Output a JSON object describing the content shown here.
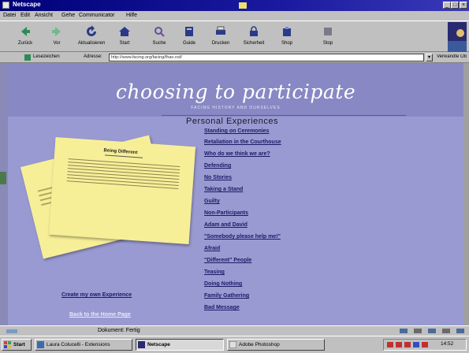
{
  "window": {
    "title": "Netscape",
    "min_glyph": "_",
    "max_glyph": "□",
    "close_glyph": "×"
  },
  "menu": [
    "Datei",
    "Edit",
    "Ansicht",
    "Gehe",
    "Communicator",
    "Hilfe"
  ],
  "toolbar": {
    "buttons": [
      {
        "label": "Zurück",
        "icon": "back-arrow-icon",
        "color": "#2e8b57"
      },
      {
        "label": "Vor",
        "icon": "forward-arrow-icon",
        "color": "#2e8b57"
      },
      {
        "label": "Aktualisieren",
        "icon": "reload-icon",
        "color": "#2a3a8a"
      },
      {
        "label": "Start",
        "icon": "home-icon",
        "color": "#2a3a8a"
      },
      {
        "label": "Suche",
        "icon": "search-icon",
        "color": "#6a4a9a"
      },
      {
        "label": "Guide",
        "icon": "guide-icon",
        "color": "#2a3a8a"
      },
      {
        "label": "Drucken",
        "icon": "print-icon",
        "color": "#2a3a8a"
      },
      {
        "label": "Sicherheit",
        "icon": "security-icon",
        "color": "#2a3a8a"
      },
      {
        "label": "Shop",
        "icon": "shop-icon",
        "color": "#2a3a8a"
      },
      {
        "label": "Stop",
        "icon": "stop-icon",
        "color": "#2a3a8a"
      }
    ]
  },
  "location": {
    "bookmarks_label": "Lesezeichen",
    "address_label": "Adresse:",
    "url": "http://www.facing.org/facing/fhao.nsf/",
    "related_label": "Verwandte Objekte"
  },
  "page": {
    "brand": "choosing to participate",
    "tagline": "FACING HISTORY AND OURSELVES",
    "section_title": "Personal Experiences",
    "links": [
      "Standing on Ceremonies",
      "Retaliation in the Courthouse",
      "Who do we think we are?",
      "Defending",
      "No Stories",
      "Taking a Stand",
      "Guilty",
      "Non-Participants",
      "Adam and David",
      "\"Somebody please help me!\"",
      "Afraid",
      "\"Different\" People",
      "Teasing",
      "Doing Nothing",
      "Family Gathering",
      "Bad Message"
    ],
    "note_title": "Being Different",
    "left_link_1": "Create my own Experience",
    "left_link_2": "Back to the Home Page",
    "colors": {
      "page_bg": "#9a9ad2",
      "note": "#f7ef98",
      "link": "#1a1a66"
    }
  },
  "status": {
    "text": "Dokument: Fertig"
  },
  "taskbar": {
    "start_label": "Start",
    "tasks": [
      {
        "label": "Laura Colucelli - Extensions",
        "icon": "app-icon"
      },
      {
        "label": "Netscape",
        "icon": "netscape-icon"
      },
      {
        "label": "Adobe Photoshop",
        "icon": "photoshop-icon"
      }
    ],
    "clock": "14:52"
  }
}
